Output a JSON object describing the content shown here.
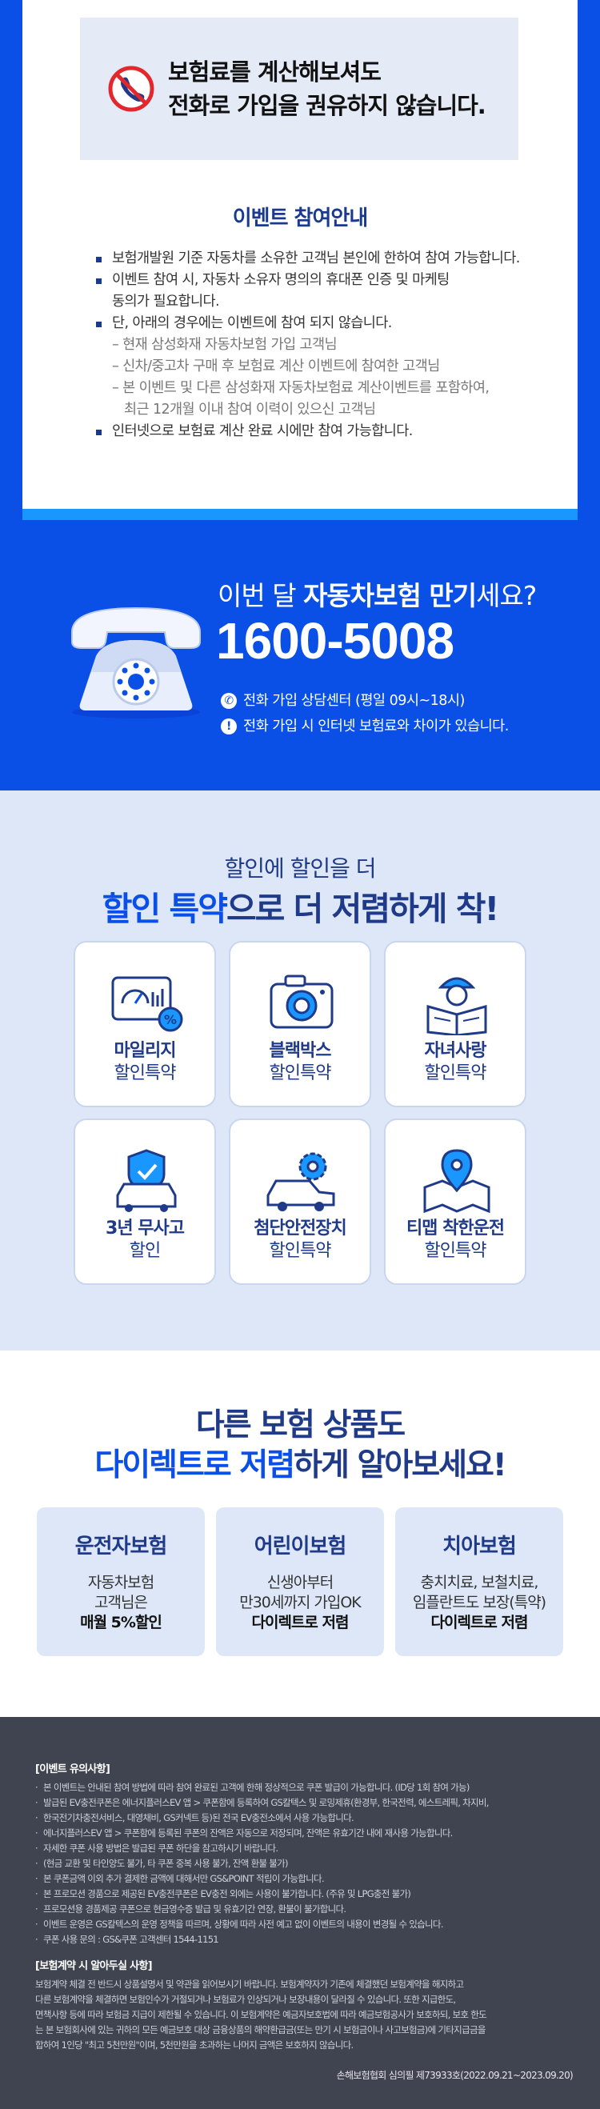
{
  "warning": {
    "line1": "보험료를 계산해보셔도",
    "line2": "전화로 가입을 권유하지 않습니다."
  },
  "event": {
    "title": "이벤트 참여안내",
    "items": [
      {
        "type": "b",
        "text": "보험개발원 기준 자동차를 소유한 고객님 본인에 한하여 참여 가능합니다."
      },
      {
        "type": "b",
        "text": "이벤트 참여 시, 자동차 소유자 명의의 휴대폰 인증 및 마케팅"
      },
      {
        "type": "c",
        "text": "동의가 필요합니다."
      },
      {
        "type": "b",
        "text": "단, 아래의 경우에는 이벤트에 참여 되지 않습니다."
      },
      {
        "type": "d",
        "text": "– 현재 삼성화재 자동차보험 가입 고객님"
      },
      {
        "type": "d",
        "text": "– 신차/중고차 구매 후 보험료 계산 이벤트에 참여한 고객님"
      },
      {
        "type": "d",
        "text": "– 본 이벤트 및 다른 삼성화재 자동차보험료 계산이벤트를 포함하여,"
      },
      {
        "type": "d2",
        "text": "최근 12개월 이내 참여 이력이 있으신 고객님"
      },
      {
        "type": "b",
        "text": "인터넷으로 보험료 계산 완료 시에만 참여 가능합니다."
      }
    ]
  },
  "call": {
    "q_pre": "이번 달 ",
    "q_bold": "자동차보험 만기",
    "q_post": "세요?",
    "number": "1600-5008",
    "info1": "전화 가입 상담센터 (평일 09시~18시)",
    "info2": "전화 가입 시 인터넷 보험료와 차이가 있습니다.",
    "icon1": "phone-icon",
    "icon2": "exclamation-icon"
  },
  "discount": {
    "sub": "할인에 할인을 더",
    "title_hl": "할인 특약",
    "title_rest": "으로 더 저렴하게 착!",
    "cards": [
      {
        "l1": "마일리지",
        "l2": "할인특약",
        "icon": "odometer-icon"
      },
      {
        "l1": "블랙박스",
        "l2": "할인특약",
        "icon": "camera-icon"
      },
      {
        "l1": "자녀사랑",
        "l2": "할인특약",
        "icon": "child-reading-icon"
      },
      {
        "l1": "3년 무사고",
        "l2": "할인",
        "icon": "car-shield-icon"
      },
      {
        "l1": "첨단안전장치",
        "l2": "할인특약",
        "icon": "car-gear-icon"
      },
      {
        "l1": "티맵 착한운전",
        "l2": "할인특약",
        "icon": "map-pin-icon"
      }
    ]
  },
  "products": {
    "title1": "다른 보험 상품도",
    "title2_hl": "다이렉트로 저렴",
    "title2_rest": "하게 알아보세요!",
    "items": [
      {
        "name": "운전자보험",
        "d1": "자동차보험",
        "d2": "고객님은",
        "d3": "매월 5%할인"
      },
      {
        "name": "어린이보험",
        "d1": "신생아부터",
        "d2": "만30세까지 가입OK",
        "d3": "다이렉트로 저렴"
      },
      {
        "name": "치아보험",
        "d1": "충치치료, 보철치료,",
        "d2": "임플란트도 보장(특약)",
        "d3": "다이렉트로 저렴"
      }
    ]
  },
  "footer": {
    "h1": "[이벤트 유의사항]",
    "lines1": [
      "본 이벤트는 안내된 참여 방법에 따라 참여 완료된 고객에 한해 정상적으로 쿠폰 발급이 가능합니다. (ID당 1회 참여 가능)",
      "발급된 EV충전쿠폰은 에너지플러스EV 앱 > 쿠폰함에 등록하여 GS칼텍스 및 로밍제휴(환경부, 한국전력, 에스트레픽, 차지비,",
      "한국전기차충전서비스, 대영채비, GS커넥트 등)된 전국 EV충전소에서 사용 가능합니다.",
      "에너지플러스EV 앱 > 쿠폰함에 등록된 쿠폰의 잔액은 자동으로 저장되며, 잔액은 유효기간 내에 재사용 가능합니다.",
      "자세한 쿠폰 사용 방법은 발급된 쿠폰 하단을 참고하시기 바랍니다.",
      "(현금 교환 및 타인양도 불가, 타 쿠폰 중복 사용 불가, 잔액 환불 불가)",
      "본 쿠폰금액 이외 추가 결제한 금액에 대해서만 GS&POINT 적립이 가능합니다.",
      "본 프로모션 경품으로 제공된 EV충전쿠폰은 EV충전 외에는 사용이 불가합니다. (주유 및 LPG충전 불가)",
      "프로모션용 경품제공 쿠폰으로 현금영수증 발급 및 유효기간 연장, 환불이 불가합니다.",
      "이벤트 운영은 GS칼텍스의 운영 정책을 따르며, 상황에 따라 사전 예고 없이 이벤트의 내용이 변경될 수 있습니다.",
      "쿠폰 사용 문의 : GS&쿠폰 고객센터 1544-1151"
    ],
    "h2": "[보험계약 시 알아두실 사항]",
    "lines2": [
      "보험계약 체결 전 반드시 상품설명서 및 약관을 읽어보시기 바랍니다. 보험계약자가 기존에 체결했던 보험계약을 해지하고",
      "다른 보험계약을 체결하면 보험인수가 거절되거나 보험료가 인상되거나 보장내용이 달라질 수 있습니다. 또한 지급한도,",
      "면책사항 등에 따라 보험금 지급이 제한될 수 있습니다. 이 보험계약은 예금자보호법에 따라 예금보험공사가 보호하되, 보호 한도",
      "는 본 보험회사에 있는 귀하의 모든 예금보호 대상 금융상품의 해약환급금(또는 만기 시 보험금이나 사고보험금)에 기타지급금을",
      "합하여 1인당 \"최고 5천만원\"이며, 5천만원을 초과하는 나머지 금액은 보호하지 않습니다."
    ],
    "note": "손해보험협회 심의필 제73933호(2022.09.21~2023.09.20)"
  }
}
